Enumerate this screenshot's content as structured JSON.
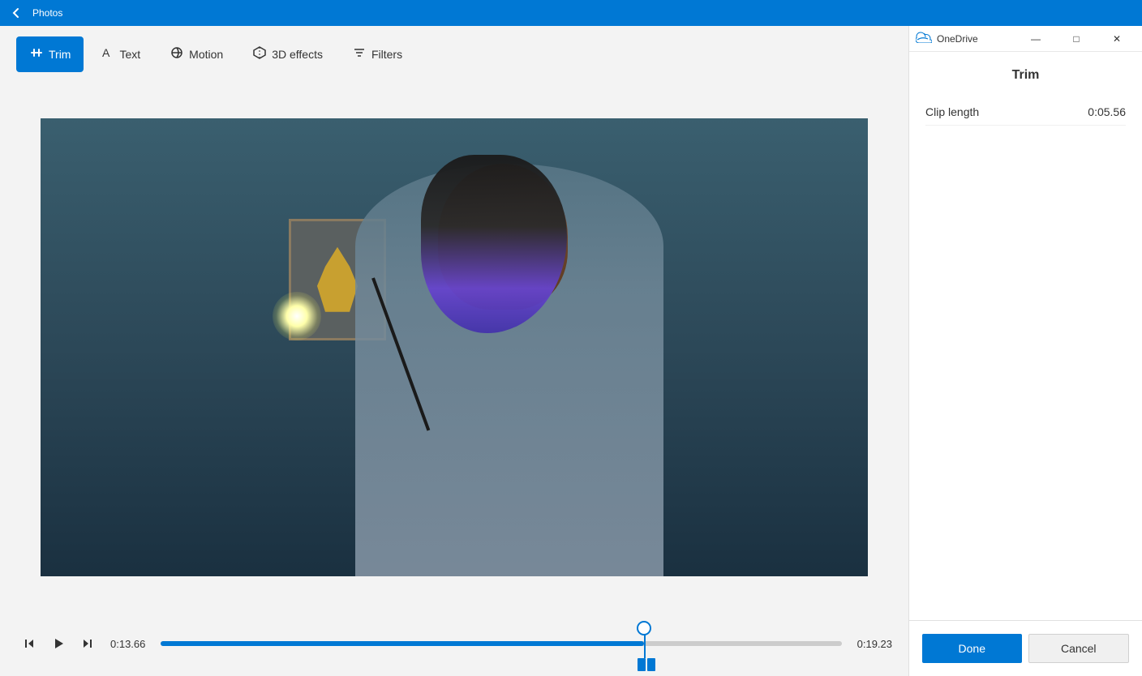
{
  "titlebar": {
    "app_name": "Photos",
    "back_label": "←"
  },
  "toolbar": {
    "buttons": [
      {
        "id": "trim",
        "label": "Trim",
        "active": true
      },
      {
        "id": "text",
        "label": "Text",
        "active": false
      },
      {
        "id": "motion",
        "label": "Motion",
        "active": false
      },
      {
        "id": "3d_effects",
        "label": "3D effects",
        "active": false
      },
      {
        "id": "filters",
        "label": "Filters",
        "active": false
      }
    ]
  },
  "timeline": {
    "current_time": "0:13.66",
    "end_time": "0:19.23",
    "progress_percent": 71
  },
  "right_panel": {
    "title": "OneDrive",
    "controls": {
      "minimize": "—",
      "maximize": "□",
      "close": "✕"
    }
  },
  "trim_panel": {
    "title": "Trim",
    "clip_length_label": "Clip length",
    "clip_length_value": "0:05.56",
    "done_label": "Done",
    "cancel_label": "Cancel"
  }
}
